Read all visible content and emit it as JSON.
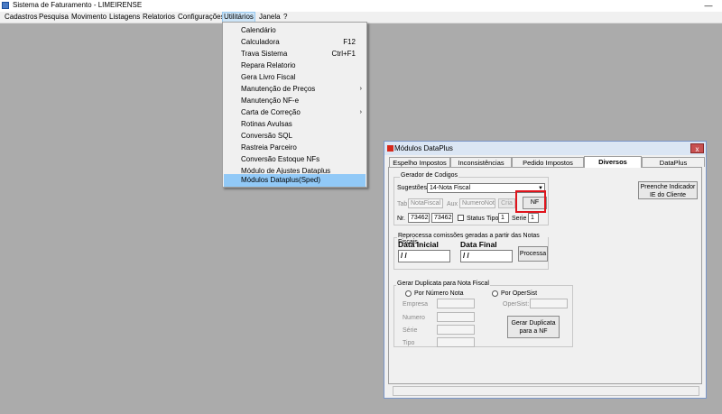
{
  "window": {
    "title": "Sistema de Faturamento - LIMEIRENSE",
    "minimize": "—"
  },
  "menu": [
    "Cadastros",
    "Pesquisa",
    "Movimento",
    "Listagens",
    "Relatorios",
    "Configurações",
    "Utilitários",
    "Janela",
    "?"
  ],
  "menu_active": "Utilitários",
  "dropdown": [
    {
      "label": "Calendário",
      "shortcut": "",
      "submenu": false
    },
    {
      "label": "Calculadora",
      "shortcut": "F12",
      "submenu": false
    },
    {
      "label": "Trava Sistema",
      "shortcut": "Ctrl+F1",
      "submenu": false
    },
    {
      "label": "Repara Relatorio",
      "shortcut": "",
      "submenu": false
    },
    {
      "label": "Gera Livro Fiscal",
      "shortcut": "",
      "submenu": false
    },
    {
      "label": "Manutenção de Preços",
      "shortcut": "",
      "submenu": true
    },
    {
      "label": "Manutenção NF-e",
      "shortcut": "",
      "submenu": false
    },
    {
      "label": "Carta de Correção",
      "shortcut": "",
      "submenu": true
    },
    {
      "label": "Rotinas Avulsas",
      "shortcut": "",
      "submenu": false
    },
    {
      "label": "Conversão SQL",
      "shortcut": "",
      "submenu": false
    },
    {
      "label": "Rastreia Parceiro",
      "shortcut": "",
      "submenu": false
    },
    {
      "label": "Conversão Estoque NFs",
      "shortcut": "",
      "submenu": false
    },
    {
      "label": "Módulo de Ajustes Dataplus",
      "shortcut": "",
      "submenu": false
    },
    {
      "label": "Módulos Dataplus(Sped)",
      "shortcut": "",
      "submenu": false,
      "highlighted": true
    }
  ],
  "submenu_arrow": "›",
  "dialog": {
    "title": "Módulos DataPlus",
    "close": "x",
    "tabs": [
      "Espelho Impostos",
      "Inconsistências",
      "Pedido Impostos",
      "Diversos",
      "DataPlus"
    ],
    "selected_tab": "Diversos",
    "gerador": {
      "legend": "Gerador de Codigos",
      "sugestoes_label": "Sugestões:",
      "sugestoes_value": "14-Nota Fiscal",
      "combo_arrow": "▼",
      "tab_label": "Tab",
      "tab_value": "NotaFiscal",
      "aux_label": "Aux",
      "aux_value": "NumeroNota",
      "cria_button": "Cria",
      "nf_button": "NF",
      "nr_label": "Nr.",
      "nr_value1": "73462",
      "nr_value2": "73462",
      "status_label": "Status",
      "tipo_label": "Tipo",
      "tipo_value": "1",
      "serie_label": "Serie",
      "serie_value": "1"
    },
    "preenche_button_line1": "Preenche Indicador",
    "preenche_button_line2": "IE do Cliente",
    "reprocessa": {
      "legend": "Reprocessa comissões geradas a partir das Notas Fiscais",
      "data_inicial_label": "Data Inicial",
      "data_inicial_value": "/ /",
      "data_final_label": "Data Final",
      "data_final_value": "/ /",
      "processa_button": "Processa"
    },
    "duplicata": {
      "legend": "Gerar Duplicata para Nota Fiscal",
      "radio1": "Por Número Nota",
      "radio2": "Por OperSist",
      "empresa_label": "Empresa",
      "opersist_label": "OperSist:",
      "numero_label": "Numero",
      "serie_label": "Série",
      "tipo_label": "Tipo",
      "gerar_button_line1": "Gerar Duplicata",
      "gerar_button_line2": "para a NF"
    }
  }
}
